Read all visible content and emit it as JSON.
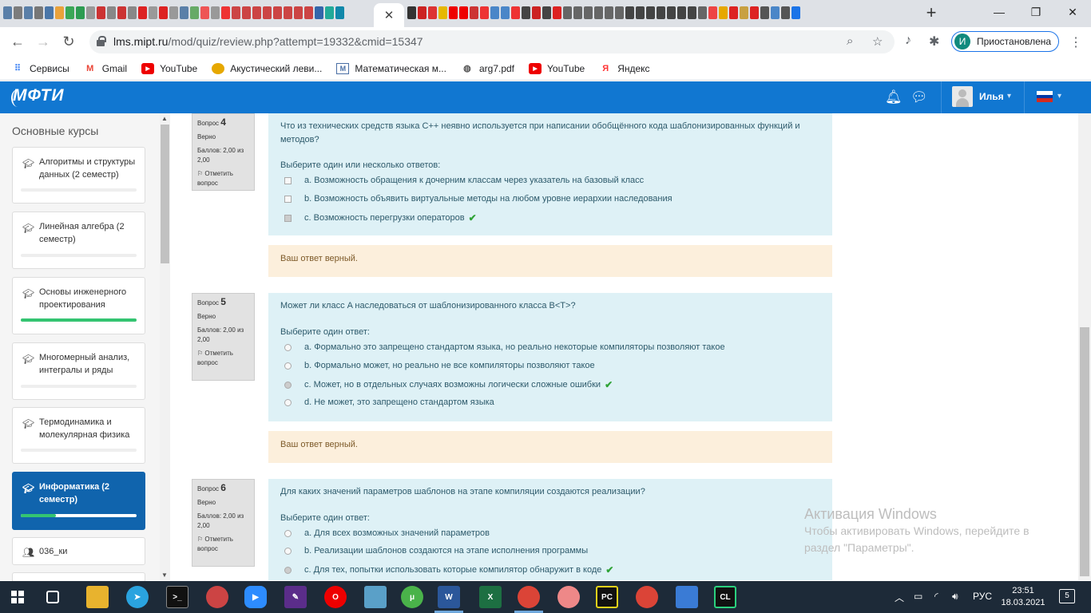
{
  "browser": {
    "url_host": "lms.mipt.ru",
    "url_path": "/mod/quiz/review.php?attempt=19332&cmid=15347",
    "profile_initial": "И",
    "profile_status": "Приостановлена",
    "bookmarks": [
      "Сервисы",
      "Gmail",
      "YouTube",
      "Акустический леви...",
      "Математическая м...",
      "arg7.pdf",
      "YouTube",
      "Яндекс"
    ]
  },
  "site": {
    "logo": "МФТИ",
    "user_name": "Илья"
  },
  "sidebar": {
    "title": "Основные курсы",
    "courses": [
      {
        "name": "Алгоритмы и структуры данных (2 семестр)",
        "progress": 0
      },
      {
        "name": "Линейная алгебра (2 семестр)",
        "progress": 0
      },
      {
        "name": "Основы инженерного проектирования",
        "progress": 1.0
      },
      {
        "name": "Многомерный анализ, интегралы и ряды",
        "progress": 0
      },
      {
        "name": "Термодинамика и молекулярная физика",
        "progress": 0
      },
      {
        "name": "Информатика (2 семестр)",
        "progress": 0.3
      },
      {
        "name": "036_ки"
      }
    ]
  },
  "questions": [
    {
      "label": "Вопрос",
      "number": "4",
      "state": "Верно",
      "grade": "Баллов: 2,00 из 2,00",
      "flag": "Отметить вопрос",
      "text": "Что из технических средств языка С++ неявно используется при написании обобщённого кода шаблонизированных функций и методов?",
      "prompt": "Выберите один или несколько ответов:",
      "options": [
        "a. Возможность обращения к дочерним классам через указатель на базовый класс",
        "b. Возможность объявить виртуальные методы на любом уровне иерархии наследования",
        "c. Возможность перегрузки операторов"
      ],
      "feedback": "Ваш ответ верный."
    },
    {
      "label": "Вопрос",
      "number": "5",
      "state": "Верно",
      "grade": "Баллов: 2,00 из 2,00",
      "flag": "Отметить вопрос",
      "text": "Может ли класс A наследоваться от шаблонизированного класса B<T>?",
      "prompt": "Выберите один ответ:",
      "options": [
        "a. Формально это запрещено стандартом языка, но реально некоторые компиляторы позволяют такое",
        "b. Формально может, но реально не все компиляторы позволяют такое",
        "c. Может, но в отдельных случаях возможны логически сложные ошибки",
        "d. Не может, это запрещено стандартом языка"
      ],
      "feedback": "Ваш ответ верный."
    },
    {
      "label": "Вопрос",
      "number": "6",
      "state": "Верно",
      "grade": "Баллов: 2,00 из 2,00",
      "flag": "Отметить вопрос",
      "text": "Для каких значений параметров шаблонов на этапе компиляции создаются реализации?",
      "prompt": "Выберите один ответ:",
      "options": [
        "a. Для всех возможных значений параметров",
        "b. Реализации шаблонов создаются на этапе исполнения программы",
        "c. Для тех, попытки использовать которые компилятор обнаружит в коде"
      ]
    }
  ],
  "activation": {
    "title": "Активация Windows",
    "line1": "Чтобы активировать Windows, перейдите в",
    "line2": "раздел \"Параметры\"."
  },
  "taskbar": {
    "lang": "РУС",
    "time": "23:51",
    "date": "18.03.2021",
    "notifications": "5"
  }
}
